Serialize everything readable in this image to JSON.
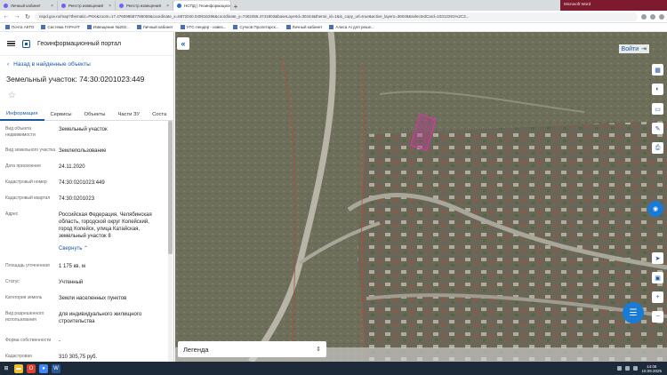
{
  "browser": {
    "tabs": [
      {
        "label": "Личный кабинет",
        "fav": "#6c63ff",
        "active": false
      },
      {
        "label": "Реестр извещений",
        "fav": "#6c63ff",
        "active": false
      },
      {
        "label": "Реестр извещений",
        "fav": "#6c63ff",
        "active": false
      },
      {
        "label": "НСПД | Геоинформационный п",
        "fav": "#2a6ad9",
        "active": true
      },
      {
        "label": "Microsoft Word",
        "fav": "#d9d9d9",
        "active": false
      }
    ],
    "url": "nspd.gov.ru/map?thematic=PKK&zoom=17.476098587786059&coordinate_x=6872040.040916296&coordinate_y=7402456.4741803&baseLayerId=30444&theme_id=1&is_copy_url=true&active_layers=36048&selectedCard=10312291%2C3...",
    "bookmarks": [
      {
        "label": "Почта АКТО"
      },
      {
        "label": "Система ГАРАНТ"
      },
      {
        "label": "Извещение №202..."
      },
      {
        "label": "Личный кабинет"
      },
      {
        "label": "УТС-лендер - извез..."
      },
      {
        "label": "Сучков Пролетарск..."
      },
      {
        "label": "Личный кабинет"
      },
      {
        "label": "Алиса АI для решe..."
      }
    ]
  },
  "panel": {
    "portal_title": "Геоинформационный портал",
    "back_label": "Назад в найденные объекты",
    "parcel_title": "Земельный участок: 74:30:0201023:449",
    "tabs": [
      "Информация",
      "Сервисы",
      "Объекты",
      "Части ЗУ",
      "Соста"
    ],
    "props": [
      {
        "k": "Вид объекта недвижимости",
        "v": "Земельный участок"
      },
      {
        "k": "Вид земельного участка",
        "v": "Землепользование"
      },
      {
        "k": "Дата присвоения",
        "v": "24.11.2020"
      },
      {
        "k": "Кадастровый номер",
        "v": "74:30:0201023:449"
      },
      {
        "k": "Кадастровый квартал",
        "v": "74:30:0201023"
      },
      {
        "k": "Адрес",
        "v": "Российская Федерация, Челябинская область, городской округ Копейский, город Копейск, улица Катайская, земельный участок 8"
      },
      {
        "k": "",
        "v": "Свернуть ⌃",
        "link": true
      },
      {
        "k": "Площадь уточненная",
        "v": "1 175 кв. м"
      },
      {
        "k": "Статус",
        "v": "Учтенный"
      },
      {
        "k": "Категория земель",
        "v": "Земли населенных пунктов"
      },
      {
        "k": "Вид разрешенного использования",
        "v": "для индивидуального жилищного строительства"
      },
      {
        "k": "Форма собственности",
        "v": "-"
      },
      {
        "k": "Кадастровая",
        "v": "310 305,75 руб."
      }
    ]
  },
  "map": {
    "login_label": "Войти",
    "legend_label": "Легенда"
  },
  "taskbar": {
    "time": "14:06",
    "date": "10.09.2025"
  }
}
